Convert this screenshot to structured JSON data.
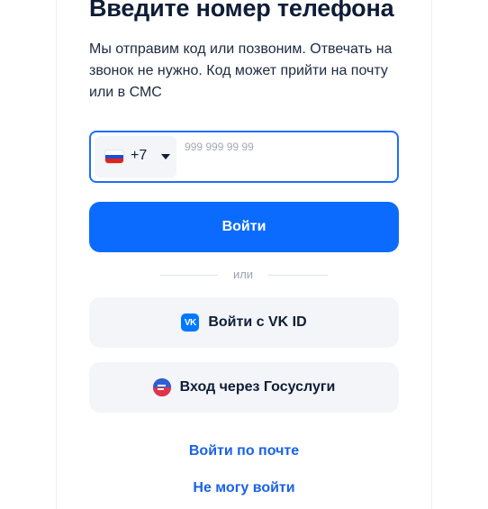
{
  "form": {
    "title": "Введите номер телефона",
    "subtitle": "Мы отправим код или позвоним. Отвечать на звонок не нужно. Код может прийти на почту или в СМС"
  },
  "phone": {
    "country_code": "+7",
    "country_flag": "russia-flag-icon",
    "placeholder": "999 999 99 99",
    "value": ""
  },
  "buttons": {
    "login_label": "Войти",
    "divider_label": "или",
    "vk_label": "Войти с VK ID",
    "gosuslugi_label": "Вход через Госуслуги"
  },
  "links": {
    "email_login": "Войти по почте",
    "cant_login": "Не могу войти"
  },
  "colors": {
    "accent": "#0b6bff",
    "link": "#1a61e8",
    "field_border": "#1f6dff",
    "secondary_bg": "#f3f5f8"
  }
}
